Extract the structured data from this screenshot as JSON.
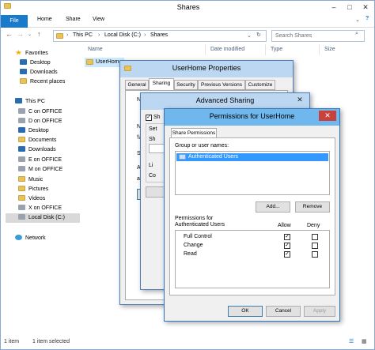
{
  "explorer": {
    "title": "Shares",
    "ribbon_tabs": [
      "File",
      "Home",
      "Share",
      "View"
    ],
    "breadcrumb": [
      "This PC",
      "Local Disk (C:)",
      "Shares"
    ],
    "search_placeholder": "Search Shares",
    "columns": [
      "Name",
      "Date modified",
      "Type",
      "Size"
    ],
    "file_row": "UserHome",
    "nav": {
      "favorites": "Favorites",
      "fav_items": [
        "Desktop",
        "Downloads",
        "Recent places"
      ],
      "thispc": "This PC",
      "pc_items": [
        "C on OFFICE",
        "D on OFFICE",
        "Desktop",
        "Documents",
        "Downloads",
        "E on OFFICE",
        "M on OFFICE",
        "Music",
        "Pictures",
        "Videos",
        "X on OFFICE",
        "Local Disk (C:)"
      ],
      "network": "Network"
    },
    "status": {
      "items": "1 item",
      "selected": "1 item selected"
    }
  },
  "props_dialog": {
    "title": "UserHome Properties",
    "tabs": [
      "General",
      "Sharing",
      "Security",
      "Previous Versions",
      "Customize"
    ],
    "frag": [
      "Ne",
      "N",
      "\\\\",
      "Se",
      "Ad",
      "ad"
    ]
  },
  "adv_dialog": {
    "title": "Advanced Sharing",
    "frag": [
      "Sh",
      "Set",
      "Sh",
      "Li",
      "Co"
    ]
  },
  "perm_dialog": {
    "title": "Permissions for UserHome",
    "tab": "Share Permissions",
    "group_label": "Group or user names:",
    "users": [
      "Authenticated Users"
    ],
    "add": "Add...",
    "remove": "Remove",
    "perm_label": "Permissions for Authenticated Users",
    "allow": "Allow",
    "deny": "Deny",
    "perms": [
      {
        "name": "Full Control",
        "allow": true,
        "deny": false
      },
      {
        "name": "Change",
        "allow": true,
        "deny": false
      },
      {
        "name": "Read",
        "allow": true,
        "deny": false
      }
    ],
    "ok": "OK",
    "cancel": "Cancel",
    "apply": "Apply"
  },
  "colors": {
    "accent": "#1979ca",
    "selection": "#3399ff",
    "titlebar_active": "#6fb7ed",
    "close_red": "#c9413b"
  }
}
